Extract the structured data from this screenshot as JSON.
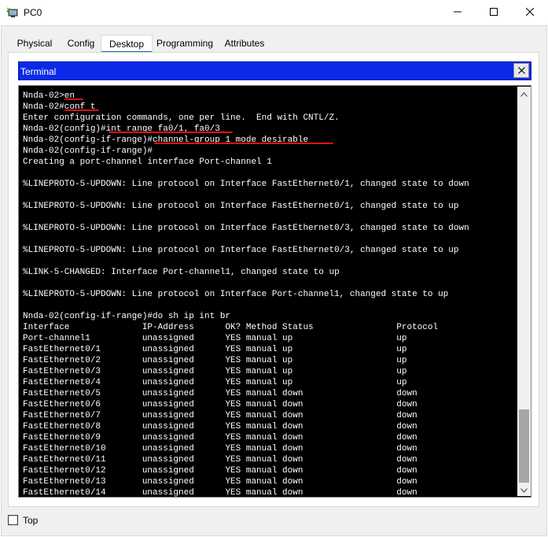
{
  "window": {
    "title": "PC0",
    "icon": "cisco-pc-icon",
    "controls": [
      "minimize-icon",
      "maximize-icon",
      "close-icon"
    ]
  },
  "tabs": [
    {
      "label": "Physical",
      "active": false
    },
    {
      "label": "Config",
      "active": false
    },
    {
      "label": "Desktop",
      "active": true
    },
    {
      "label": "Programming",
      "active": false
    },
    {
      "label": "Attributes",
      "active": false
    }
  ],
  "terminal": {
    "title": "Terminal",
    "close_label": "X",
    "lines": [
      "Nnda-02>en",
      "Nnda-02#conf t",
      "Enter configuration commands, one per line.  End with CNTL/Z.",
      "Nnda-02(config)#int range fa0/1, fa0/3",
      "Nnda-02(config-if-range)#channel-group 1 mode desirable",
      "Nnda-02(config-if-range)#",
      "Creating a port-channel interface Port-channel 1",
      "",
      "%LINEPROTO-5-UPDOWN: Line protocol on Interface FastEthernet0/1, changed state to down",
      "",
      "%LINEPROTO-5-UPDOWN: Line protocol on Interface FastEthernet0/1, changed state to up",
      "",
      "%LINEPROTO-5-UPDOWN: Line protocol on Interface FastEthernet0/3, changed state to down",
      "",
      "%LINEPROTO-5-UPDOWN: Line protocol on Interface FastEthernet0/3, changed state to up",
      "",
      "%LINK-5-CHANGED: Interface Port-channel1, changed state to up",
      "",
      "%LINEPROTO-5-UPDOWN: Line protocol on Interface Port-channel1, changed state to up",
      "",
      "Nnda-02(config-if-range)#do sh ip int br",
      "Interface              IP-Address      OK? Method Status                Protocol",
      "Port-channel1          unassigned      YES manual up                    up",
      "FastEthernet0/1        unassigned      YES manual up                    up",
      "FastEthernet0/2        unassigned      YES manual up                    up",
      "FastEthernet0/3        unassigned      YES manual up                    up",
      "FastEthernet0/4        unassigned      YES manual up                    up",
      "FastEthernet0/5        unassigned      YES manual down                  down",
      "FastEthernet0/6        unassigned      YES manual down                  down",
      "FastEthernet0/7        unassigned      YES manual down                  down",
      "FastEthernet0/8        unassigned      YES manual down                  down",
      "FastEthernet0/9        unassigned      YES manual down                  down",
      "FastEthernet0/10       unassigned      YES manual down                  down",
      "FastEthernet0/11       unassigned      YES manual down                  down",
      "FastEthernet0/12       unassigned      YES manual down                  down",
      "FastEthernet0/13       unassigned      YES manual down                  down",
      "FastEthernet0/14       unassigned      YES manual down                  down"
    ],
    "annotation_color": "#e01010"
  },
  "footer": {
    "top_label": "Top",
    "top_checked": false
  },
  "colors": {
    "terminal_header": "#0a2ae8",
    "terminal_bg": "#000000",
    "terminal_text": "#ffffff",
    "active_tab_underline": "#1a66c2"
  }
}
